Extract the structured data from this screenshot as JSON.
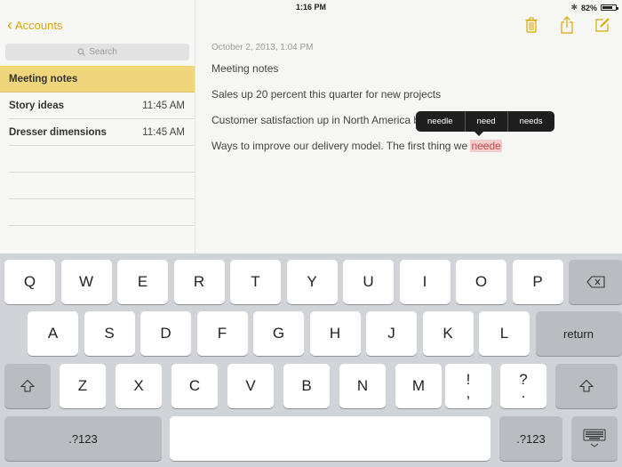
{
  "status_bar": {
    "device": "iPad",
    "time": "1:16 PM",
    "battery_percent": "82%",
    "battery_level": 0.82
  },
  "sidebar": {
    "back_label": "Accounts",
    "search_placeholder": "Search",
    "notes": [
      {
        "title": "Meeting notes",
        "time": "",
        "selected": true
      },
      {
        "title": "Story ideas",
        "time": "11:45 AM"
      },
      {
        "title": "Dresser dimensions",
        "time": "11:45 AM"
      }
    ]
  },
  "toolbar": {
    "trash": "trash-icon",
    "share": "share-icon",
    "compose": "compose-icon"
  },
  "note": {
    "date": "October 2, 2013, 1:04 PM",
    "lines": [
      "Meeting notes",
      "Sales up 20 percent this quarter for new projects",
      "Customer satisfaction up in North America by 10%"
    ],
    "last_line_prefix": "Ways to improve our delivery model.  The first thing we ",
    "misspelled_word": "neede"
  },
  "suggestions": [
    "needle",
    "need",
    "needs"
  ],
  "keyboard": {
    "row1": [
      "Q",
      "W",
      "E",
      "R",
      "T",
      "Y",
      "U",
      "I",
      "O",
      "P"
    ],
    "row2": [
      "A",
      "S",
      "D",
      "F",
      "G",
      "H",
      "J",
      "K",
      "L"
    ],
    "row3": [
      "Z",
      "X",
      "C",
      "V",
      "B",
      "N",
      "M"
    ],
    "exclaim_top": "!",
    "exclaim_bottom": ",",
    "question_top": "?",
    "question_bottom": ".",
    "return_label": "return",
    "numbers_label": ".?123"
  },
  "colors": {
    "accent": "#d9a900",
    "selected_note": "#f0d57a",
    "misspelled_bg": "#f6cccc"
  }
}
